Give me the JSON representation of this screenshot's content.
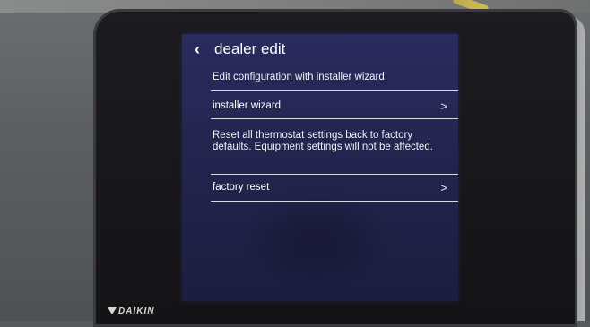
{
  "screen": {
    "title": "dealer edit",
    "back_icon": "chevron-left-icon",
    "sections": [
      {
        "description": "Edit configuration with installer wizard.",
        "action_label": "installer wizard",
        "action_icon": "chevron-right-icon"
      },
      {
        "description": "Reset all thermostat settings back to factory defaults. Equipment settings will not be affected.",
        "action_label": "factory reset",
        "action_icon": "chevron-right-icon"
      }
    ]
  },
  "device": {
    "brand": "DAIKIN"
  },
  "colors": {
    "screen_bg": "#23254f",
    "text": "#ffffff",
    "divider": "#d8d8e6",
    "bezel": "#1c1b1f"
  }
}
